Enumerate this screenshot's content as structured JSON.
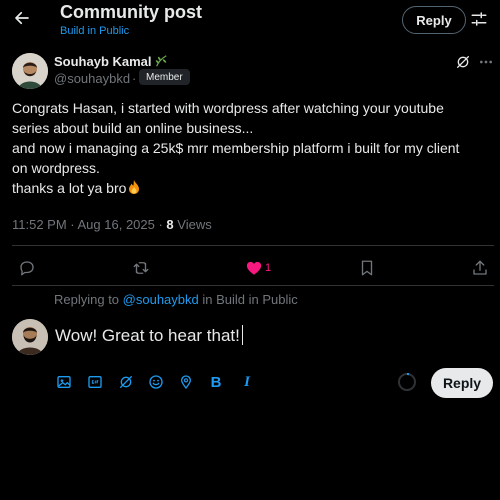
{
  "header": {
    "title": "Community post",
    "subtitle": "Build in Public",
    "reply_label": "Reply"
  },
  "post": {
    "author_name": "Souhayb Kamal",
    "author_handle": "@souhaybkd",
    "separator": "·",
    "badge": "Member",
    "lines": [
      "Congrats Hasan, i started with wordpress after watching your youtube",
      "series about build an online business...",
      "and now i managing a 25k$ mrr membership platform i built for my client",
      "on wordpress.",
      "thanks a lot ya bro"
    ],
    "emoji": "🔥",
    "time": "11:52 PM · Aug 16, 2025 · ",
    "views_count": "8",
    "views_label": " Views",
    "like_count": "1"
  },
  "composer": {
    "replying_prefix": "Replying to ",
    "replying_handle": "@souhaybkd",
    "replying_suffix": " in Build in Public",
    "text": "Wow! Great to hear that!",
    "reply_label": "Reply",
    "bold_label": "B",
    "italic_label": "I"
  },
  "colors": {
    "accent": "#1d9bf0",
    "like": "#f91880",
    "background": "#000000"
  },
  "icons": [
    "back-arrow-icon",
    "tune-icon",
    "leaf-icon",
    "grok-icon",
    "more-icon",
    "reply-bubble-icon",
    "repost-icon",
    "heart-icon",
    "bookmark-icon",
    "share-icon",
    "image-icon",
    "gif-icon",
    "grok-icon",
    "emoji-icon",
    "location-icon",
    "bold-icon",
    "italic-icon"
  ]
}
